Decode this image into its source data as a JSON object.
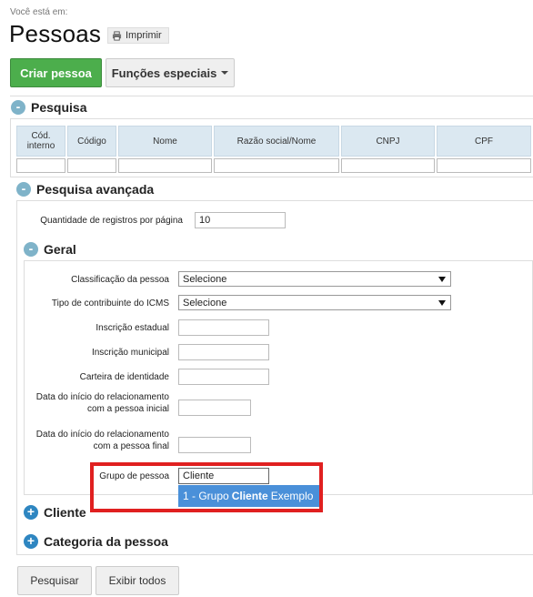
{
  "breadcrumb": "Você está em:",
  "page_title": "Pessoas",
  "print_label": "Imprimir",
  "toolbar": {
    "create_label": "Criar pessoa",
    "special_label": "Funções especiais"
  },
  "search": {
    "title": "Pesquisa",
    "columns": [
      "Cód. interno",
      "Código",
      "Nome",
      "Razão social/Nome",
      "CNPJ",
      "CPF"
    ]
  },
  "advanced": {
    "title": "Pesquisa avançada",
    "records_label": "Quantidade de registros por página",
    "records_value": "10"
  },
  "general": {
    "title": "Geral",
    "classificacao_label": "Classificação da pessoa",
    "classificacao_value": "Selecione",
    "icms_label": "Tipo de contribuinte do ICMS",
    "icms_value": "Selecione",
    "inscricao_estadual_label": "Inscrição estadual",
    "inscricao_municipal_label": "Inscrição municipal",
    "identidade_label": "Carteira de identidade",
    "data_inicial_label": "Data do início do relacionamento com a pessoa inicial",
    "data_final_label": "Data do início do relacionamento com a pessoa final",
    "grupo_label": "Grupo de pessoa",
    "grupo_value": "Cliente",
    "suggestion_prefix": "1 - Grupo",
    "suggestion_match": "Cliente",
    "suggestion_suffix": "Exemplo"
  },
  "sections": {
    "cliente": "Cliente",
    "categoria": "Categoria da pessoa"
  },
  "footer": {
    "search_label": "Pesquisar",
    "show_all_label": "Exibir todos"
  },
  "colors": {
    "primary": "#4cae4c",
    "highlight": "#e02020",
    "suggestion": "#4a90d9",
    "header_bg": "#dbe8f1"
  }
}
